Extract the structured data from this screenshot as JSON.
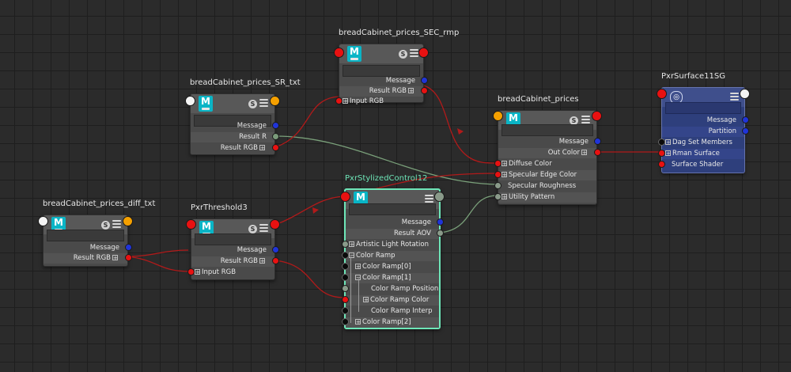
{
  "colors": {
    "background": "#2b2b2b",
    "node_body": "#4a4a4a",
    "shading_group": "#2e3f7c",
    "selection": "#6ee6b8",
    "wire_red": "#b11a1a",
    "wire_green": "#7aa07a",
    "port_red": "#e81111",
    "port_blue": "#2034d8",
    "port_orange": "#f5a000"
  },
  "nodes": {
    "sec_rmp": {
      "title": "breadCabinet_prices_SEC_rmp",
      "icon": "maya-node-icon",
      "icon_letter": "M",
      "badge": "S",
      "outputs": [
        "Message",
        "Result RGB"
      ],
      "inputs": [
        "Input RGB"
      ]
    },
    "sr_txt": {
      "title": "breadCabinet_prices_SR_txt",
      "icon": "maya-node-icon",
      "icon_letter": "M",
      "badge": "S",
      "outputs": [
        "Message",
        "Result R",
        "Result RGB"
      ]
    },
    "prices": {
      "title": "breadCabinet_prices",
      "icon": "maya-node-icon",
      "icon_letter": "M",
      "badge": "S",
      "outputs": [
        "Message",
        "Out Color"
      ],
      "inputs": [
        "Diffuse Color",
        "Specular Edge Color",
        "Specular Roughness",
        "Utility Pattern"
      ]
    },
    "sg": {
      "title": "PxrSurface11SG",
      "icon": "shading-group-icon",
      "outputs": [
        "Message",
        "Partition"
      ],
      "inputs": [
        "Dag Set Members",
        "Rman Surface",
        "Surface Shader"
      ]
    },
    "diff_txt": {
      "title": "breadCabinet_prices_diff_txt",
      "icon": "maya-node-icon",
      "icon_letter": "M",
      "badge": "S",
      "outputs": [
        "Message",
        "Result RGB"
      ]
    },
    "threshold": {
      "title": "PxrThreshold3",
      "icon": "maya-node-icon",
      "icon_letter": "M",
      "badge": "S",
      "outputs": [
        "Message",
        "Result RGB"
      ],
      "inputs": [
        "Input RGB"
      ]
    },
    "stylized": {
      "title": "PxrStylizedControl12",
      "icon": "maya-node-icon",
      "icon_letter": "M",
      "outputs": [
        "Message",
        "Result AOV"
      ],
      "inputs": [
        "Artistic Light Rotation",
        "Color Ramp",
        "Color Ramp[0]",
        "Color Ramp[1]",
        "Color Ramp Position",
        "Color Ramp Color",
        "Color Ramp Interp",
        "Color Ramp[2]"
      ]
    }
  }
}
